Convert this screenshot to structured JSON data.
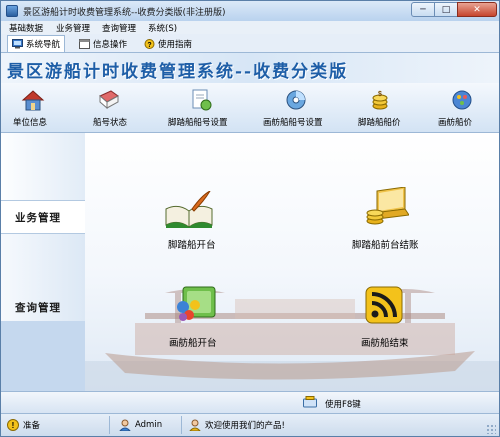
{
  "window": {
    "title": "景区游船计时收费管理系统--收费分类版(非注册版)",
    "controls": {
      "minimize": "─",
      "maximize": "□",
      "close": "✕"
    }
  },
  "menubar": {
    "items": [
      {
        "label": "基础数据"
      },
      {
        "label": "业务管理"
      },
      {
        "label": "查询管理"
      },
      {
        "label": "系统(S)"
      }
    ]
  },
  "tabs": [
    {
      "label": "系统导航",
      "icon": "monitor-icon",
      "active": true
    },
    {
      "label": "信息操作",
      "icon": "window-icon",
      "active": false
    },
    {
      "label": "使用指南",
      "icon": "help-icon",
      "active": false
    }
  ],
  "banner": {
    "text": "景区游船计时收费管理系统--收费分类版"
  },
  "toolbar": {
    "items": [
      {
        "label": "单位信息",
        "icon": "house-icon"
      },
      {
        "label": "船号状态",
        "icon": "book-icon"
      },
      {
        "label": "脚踏船船号设置",
        "icon": "document-icon"
      },
      {
        "label": "画舫船船号设置",
        "icon": "disc-icon"
      },
      {
        "label": "脚踏船船价",
        "icon": "coins-icon"
      },
      {
        "label": "画舫船价",
        "icon": "palette-icon"
      }
    ]
  },
  "sidebar": {
    "tabs": [
      {
        "label": "业务管理",
        "active": true
      },
      {
        "label": "查询管理",
        "active": false
      }
    ]
  },
  "functions": [
    {
      "label": "脚踏船开台",
      "icon": "open-book-quill-icon"
    },
    {
      "label": "脚踏船前台结账",
      "icon": "laptop-coins-icon"
    },
    {
      "label": "画舫船开台",
      "icon": "colorful-folder-icon"
    },
    {
      "label": "画舫船结束",
      "icon": "rss-icon"
    }
  ],
  "helpbar": {
    "label": "使用F8键"
  },
  "statusbar": {
    "ready": "准备",
    "user": "Admin",
    "message": "欢迎使用我们的产品!"
  },
  "colors": {
    "banner_text": "#1e5ea7",
    "window_frame": "#5a7fa8",
    "close_button": "#c6452d"
  }
}
